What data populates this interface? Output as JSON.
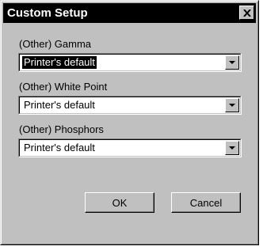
{
  "window": {
    "title": "Custom Setup",
    "close_icon": "close-icon"
  },
  "fields": [
    {
      "label": "(Other) Gamma",
      "value": "Printer's default",
      "focused": true
    },
    {
      "label": "(Other) White Point",
      "value": "Printer's default",
      "focused": false
    },
    {
      "label": "(Other) Phosphors",
      "value": "Printer's default",
      "focused": false
    }
  ],
  "buttons": {
    "ok_label": "OK",
    "cancel_label": "Cancel"
  },
  "colors": {
    "face": "#c0c0c0",
    "titlebar": "#000000",
    "highlight": "#000000"
  },
  "icons": {
    "dropdown": "chevron-down-icon"
  }
}
